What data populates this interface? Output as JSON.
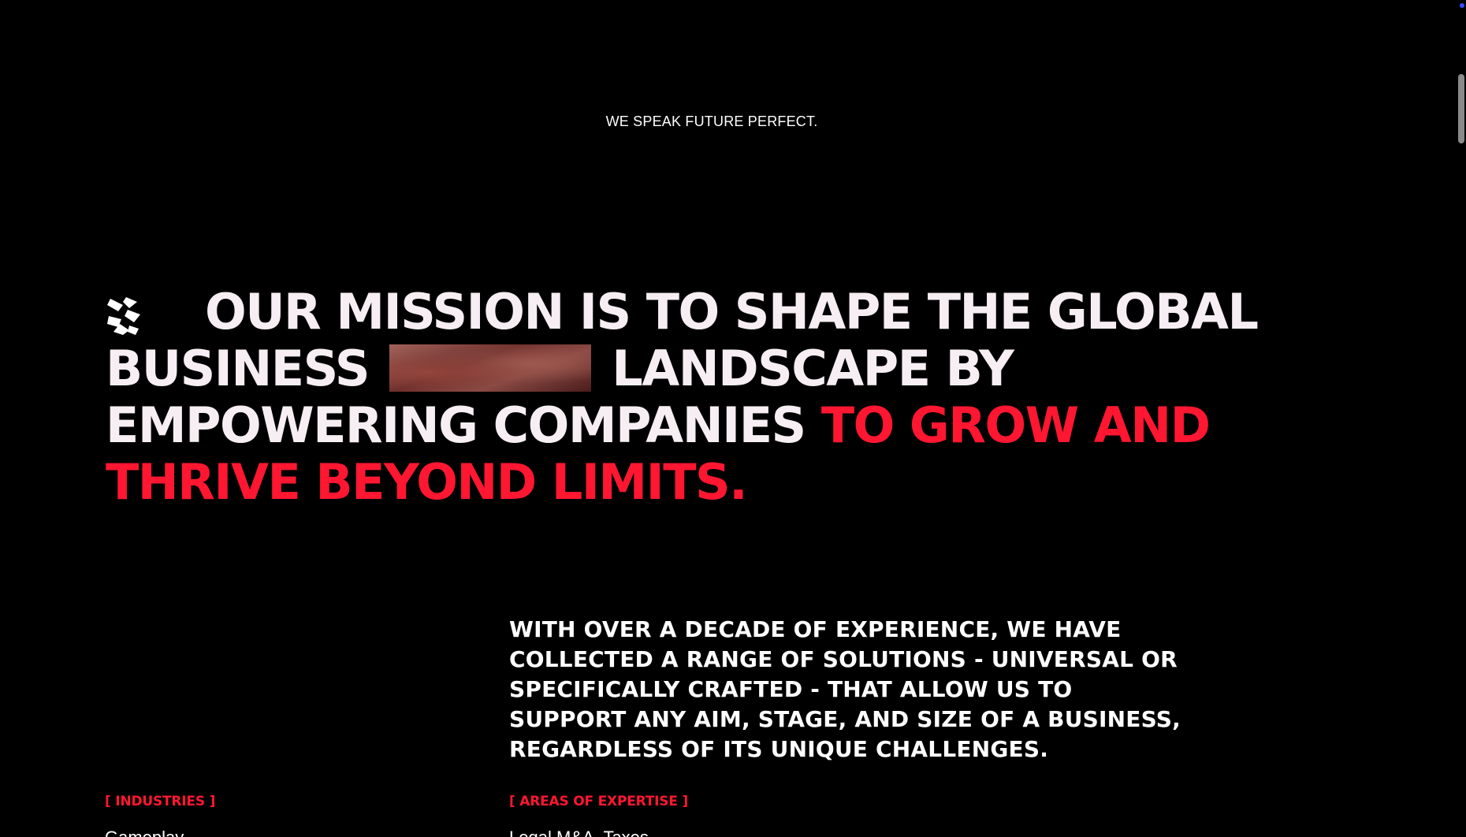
{
  "tagline": "WE SPEAK FUTURE PERFECT.",
  "mission": {
    "part1": "OUR MISSION IS TO SHAPE THE GLOBAL BUSINESS",
    "part2": "LANDSCAPE BY EMPOWERING COMPANIES",
    "accent": "TO GROW AND THRIVE BEYOND LIMITS.",
    "logo_icon": "brand-logo-icon",
    "accent_color": "#ff1731"
  },
  "intro": "WITH OVER A DECADE OF EXPERIENCE, WE HAVE COLLECTED A RANGE OF SOLUTIONS - UNIVERSAL OR SPECIFICALLY CRAFTED - THAT ALLOW US TO SUPPORT ANY AIM, STAGE, AND SIZE OF A BUSINESS, REGARDLESS OF ITS UNIQUE CHALLENGES.",
  "industries": {
    "label": "[ INDUSTRIES ]",
    "first_item": "Gameplay"
  },
  "expertise": {
    "label": "[ AREAS OF EXPERTISE ]",
    "first_item": "Legal M&A, Taxes"
  }
}
